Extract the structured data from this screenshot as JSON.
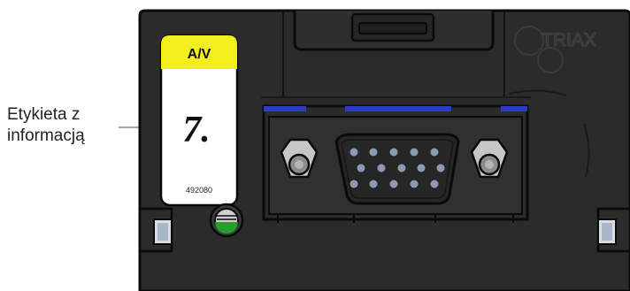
{
  "callout": {
    "line1": "Etykieta z",
    "line2": "informacją"
  },
  "module_label": {
    "band": "A/V",
    "channel": "7.",
    "code": "492080"
  },
  "brand": "TRIAX",
  "colors": {
    "module_body": "#2b2b2b",
    "outline": "#0a0a0a",
    "label_yellow": "#f2ef1c",
    "accent_blue": "#2c3fc4",
    "led_green": "#1fa12a"
  },
  "icons": {
    "arrow": "arrow-icon",
    "logo": "triax-logo-icon",
    "led": "led-indicator-icon",
    "connector": "vga-connector-icon",
    "screw": "screw-icon"
  }
}
